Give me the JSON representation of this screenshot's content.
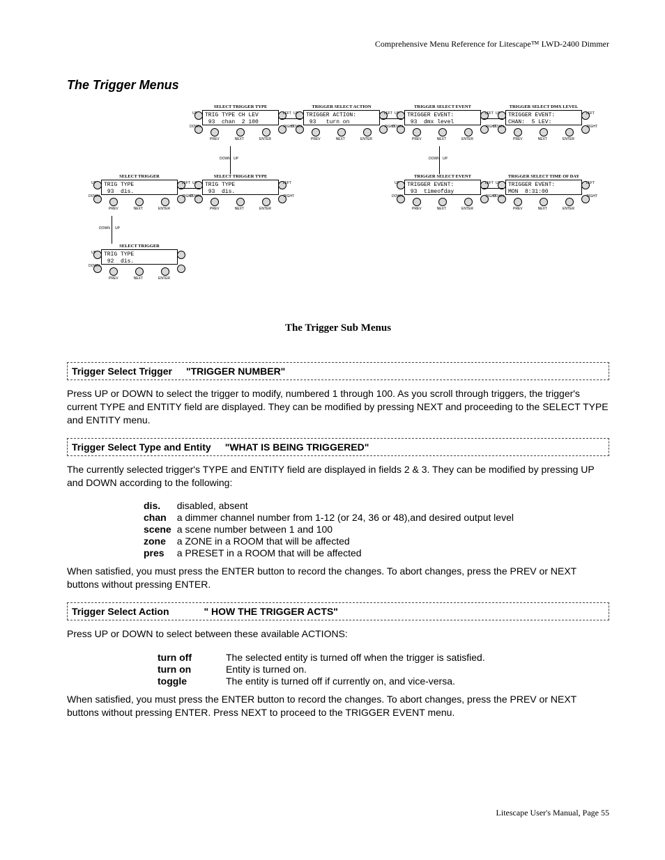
{
  "running_header": "Comprehensive Menu Reference for Litescape™ LWD-2400 Dimmer",
  "section_title": "The Trigger Menus",
  "sub_title": "The Trigger Sub Menus",
  "labels": {
    "up": "UP",
    "down": "DOWN",
    "left": "LEFT",
    "right": "RIGHT",
    "prev": "PREV",
    "next": "NEXT",
    "enter": "ENTER"
  },
  "boxes": {
    "r1c1": {
      "title": "SELECT TRIGGER TYPE",
      "l1": "TRIG TYPE CH LEV",
      "l2": " 93  chan  2 100"
    },
    "r1c2": {
      "title": "TRIGGER SELECT ACTION",
      "l1": "TRIGGER ACTION:",
      "l2": " 93   turn on"
    },
    "r1c3": {
      "title": "TRIGGER SELECT EVENT",
      "l1": "TRIGGER EVENT:",
      "l2": " 93  dmx level"
    },
    "r1c4": {
      "title": "TRIGGER SELECT DMX LEVEL",
      "l1": "TRIGGER EVENT:",
      "l2": "CHAN:  5 LEV:"
    },
    "r2c0": {
      "title": "SELECT TRIGGER",
      "l1": "TRIG TYPE",
      "l2": " 93  dis."
    },
    "r2c1": {
      "title": "SELECT TRIGGER TYPE",
      "l1": "TRIG TYPE",
      "l2": " 93  dis."
    },
    "r2c3": {
      "title": "TRIGGER SELECT EVENT",
      "l1": "TRIGGER EVENT:",
      "l2": " 93  timeofday"
    },
    "r2c4": {
      "title": "TRIGGER SELECT TIME OF DAY",
      "l1": "TRIGGER EVENT:",
      "l2": "MON  8:31:00"
    },
    "r3c0": {
      "title": "SELECT TRIGGER",
      "l1": "TRIG TYPE",
      "l2": " 92  dis."
    }
  },
  "h1": {
    "lead": "Trigger Select Trigger",
    "quote": "\"TRIGGER NUMBER\""
  },
  "p1": "Press UP or DOWN to select the trigger to modify, numbered 1 through 100. As you scroll through triggers, the trigger's current TYPE and ENTITY field are displayed. They can be modified by pressing NEXT and proceeding to the SELECT TYPE and ENTITY menu.",
  "h2": {
    "lead": "Trigger Select Type and Entity",
    "quote": "\"WHAT IS BEING TRIGGERED\""
  },
  "p2": "The currently selected trigger's TYPE and ENTITY field are displayed in fields 2 & 3. They can be modified by pressing UP and DOWN according to the following:",
  "defs1": [
    {
      "term": "dis.",
      "desc": "disabled, absent"
    },
    {
      "term": "chan",
      "desc": "a dimmer channel number from 1-12 (or 24, 36 or 48),and desired output level"
    },
    {
      "term": "scene",
      "desc": "a scene number between 1 and 100"
    },
    {
      "term": "zone",
      "desc": "a ZONE in a ROOM that will be affected"
    },
    {
      "term": "pres",
      "desc": "a PRESET in a ROOM that will be affected"
    }
  ],
  "p3": "When satisfied, you must press the ENTER button to record the changes. To abort changes, press the PREV or NEXT buttons without pressing ENTER.",
  "h3": {
    "lead": "Trigger Select Action",
    "quote": "\" HOW THE TRIGGER ACTS\""
  },
  "p4": "Press UP or DOWN to select between these available ACTIONS:",
  "defs2": [
    {
      "term": "turn off",
      "desc": "The selected entity is turned off when the trigger is satisfied."
    },
    {
      "term": "turn on",
      "desc": "Entity is turned on."
    },
    {
      "term": "toggle",
      "desc": "The entity is turned off if currently on, and vice-versa."
    }
  ],
  "p5": "When satisfied, you must press the ENTER button to record the changes. To abort changes, press the PREV or NEXT buttons without pressing ENTER. Press NEXT to proceed to the TRIGGER EVENT menu.",
  "footer": "Litescape User's Manual, Page 55"
}
